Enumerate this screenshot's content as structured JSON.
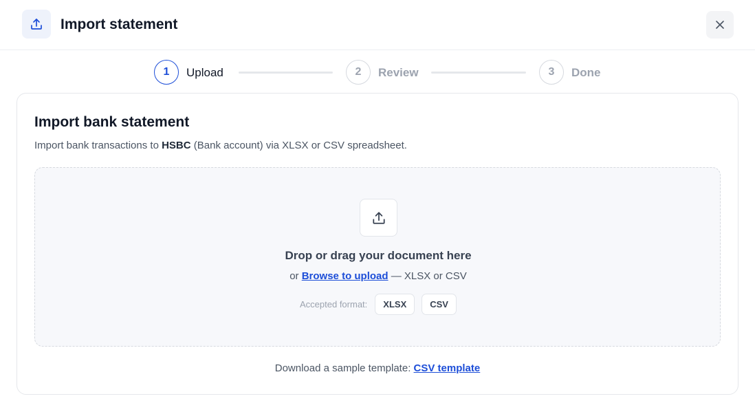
{
  "dialog": {
    "title": "Import statement",
    "header_icon": "upload-icon",
    "close_icon": "close-icon"
  },
  "steps": [
    {
      "number": "1",
      "label": "Upload",
      "state": "active"
    },
    {
      "number": "2",
      "label": "Review",
      "state": "inactive"
    },
    {
      "number": "3",
      "label": "Done",
      "state": "inactive"
    }
  ],
  "card": {
    "title": "Import bank statement",
    "desc_prefix": "Import bank transactions to ",
    "account_name": "HSBC",
    "desc_suffix": " (Bank account) via XLSX or CSV spreadsheet."
  },
  "dropzone": {
    "icon": "upload-icon",
    "title": "Drop or drag your document here",
    "sub_prefix": "or ",
    "browse_link": "Browse to upload",
    "sub_suffix": " — XLSX or CSV",
    "formats_label": "Accepted format:",
    "formats": [
      "XLSX",
      "CSV"
    ]
  },
  "template": {
    "prefix": "Download a sample template: ",
    "link": "CSV template"
  },
  "colors": {
    "accent": "#1d4ed8",
    "muted": "#9ca3af",
    "dropzone_bg": "#f7f8fb"
  }
}
